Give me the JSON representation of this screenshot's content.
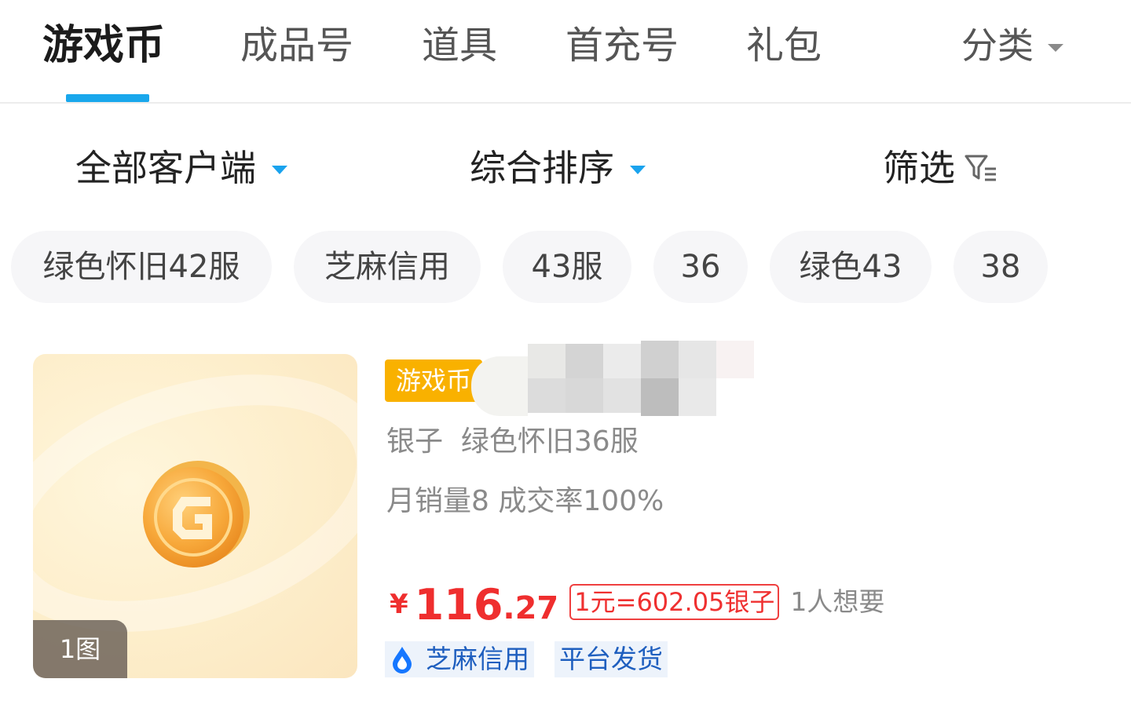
{
  "tabs": [
    {
      "label": "游戏币",
      "active": true
    },
    {
      "label": "成品号",
      "active": false
    },
    {
      "label": "道具",
      "active": false
    },
    {
      "label": "首充号",
      "active": false
    },
    {
      "label": "礼包",
      "active": false
    }
  ],
  "category": {
    "label": "分类",
    "icon": "caret-down-icon"
  },
  "filters": {
    "client": {
      "label": "全部客户端",
      "icon": "caret-down-icon"
    },
    "sort": {
      "label": "综合排序",
      "icon": "caret-down-icon"
    },
    "screen": {
      "label": "筛选",
      "icon": "filter-icon"
    }
  },
  "chips": [
    "绿色怀旧42服",
    "芝麻信用",
    "43服",
    "36",
    "绿色43",
    "38"
  ],
  "product": {
    "image_count": "1图",
    "tag": "游戏币",
    "title": "银子  绿色怀旧36服",
    "sales": "月销量8 成交率100%",
    "currency": "¥",
    "price_int": "116",
    "price_dec": ".27",
    "rate": "1元=602.05银子",
    "wants": "1人想要",
    "badges": [
      {
        "label": "芝麻信用",
        "icon": "sesame-credit-icon"
      },
      {
        "label": "平台发货",
        "icon": ""
      }
    ]
  },
  "colors": {
    "accent": "#19a7ec",
    "price": "#ef2e2e",
    "tag": "#f9b100",
    "badge_text": "#1f5fbf",
    "badge_bg": "#edf3fb"
  }
}
